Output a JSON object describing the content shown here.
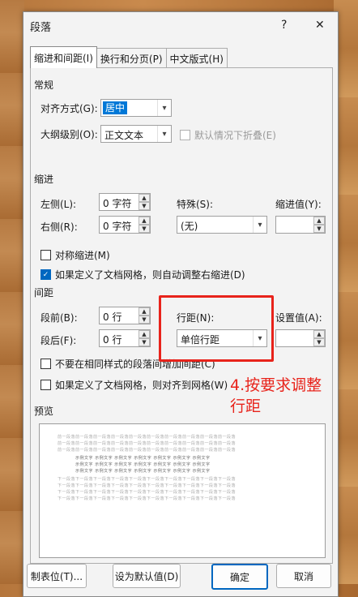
{
  "dialog": {
    "title": "段落",
    "help": "?",
    "close": "✕"
  },
  "tabs": [
    "缩进和间距(I)",
    "换行和分页(P)",
    "中文版式(H)"
  ],
  "general": {
    "heading": "常规",
    "alignment_label": "对齐方式(G):",
    "alignment_value": "居中",
    "outline_label": "大纲级别(O):",
    "outline_value": "正文文本",
    "collapse_label": "默认情况下折叠(E)"
  },
  "indent": {
    "heading": "缩进",
    "left_label": "左侧(L):",
    "left_value": "0 字符",
    "right_label": "右侧(R):",
    "right_value": "0 字符",
    "special_label": "特殊(S):",
    "special_value": "(无)",
    "by_label": "缩进值(Y):",
    "mirror_label": "对称缩进(M)",
    "autoadjust_label": "如果定义了文档网格，则自动调整右缩进(D)"
  },
  "spacing": {
    "heading": "间距",
    "before_label": "段前(B):",
    "before_value": "0 行",
    "after_label": "段后(F):",
    "after_value": "0 行",
    "line_label": "行距(N):",
    "line_value": "单倍行距",
    "at_label": "设置值(A):",
    "nospace_label": "不要在相同样式的段落间增加间距(C)",
    "snapgrid_label": "如果定义了文档网格，则对齐到网格(W)"
  },
  "preview": {
    "heading": "预览",
    "prev_line": "前一段落前一段落前一段落前一段落前一段落前一段落前一段落前一段落前一段落前一段落",
    "sample_line": "示例文字 示例文字 示例文字 示例文字 示例文字 示例文字 示例文字",
    "next_line": "下一段落下一段落下一段落下一段落下一段落下一段落下一段落下一段落下一段落下一段落"
  },
  "buttons": {
    "tabs": "制表位(T)...",
    "default": "设为默认值(D)",
    "ok": "确定",
    "cancel": "取消"
  },
  "annotation": {
    "text": "4.按要求调整行距",
    "color": "#e8231b"
  }
}
